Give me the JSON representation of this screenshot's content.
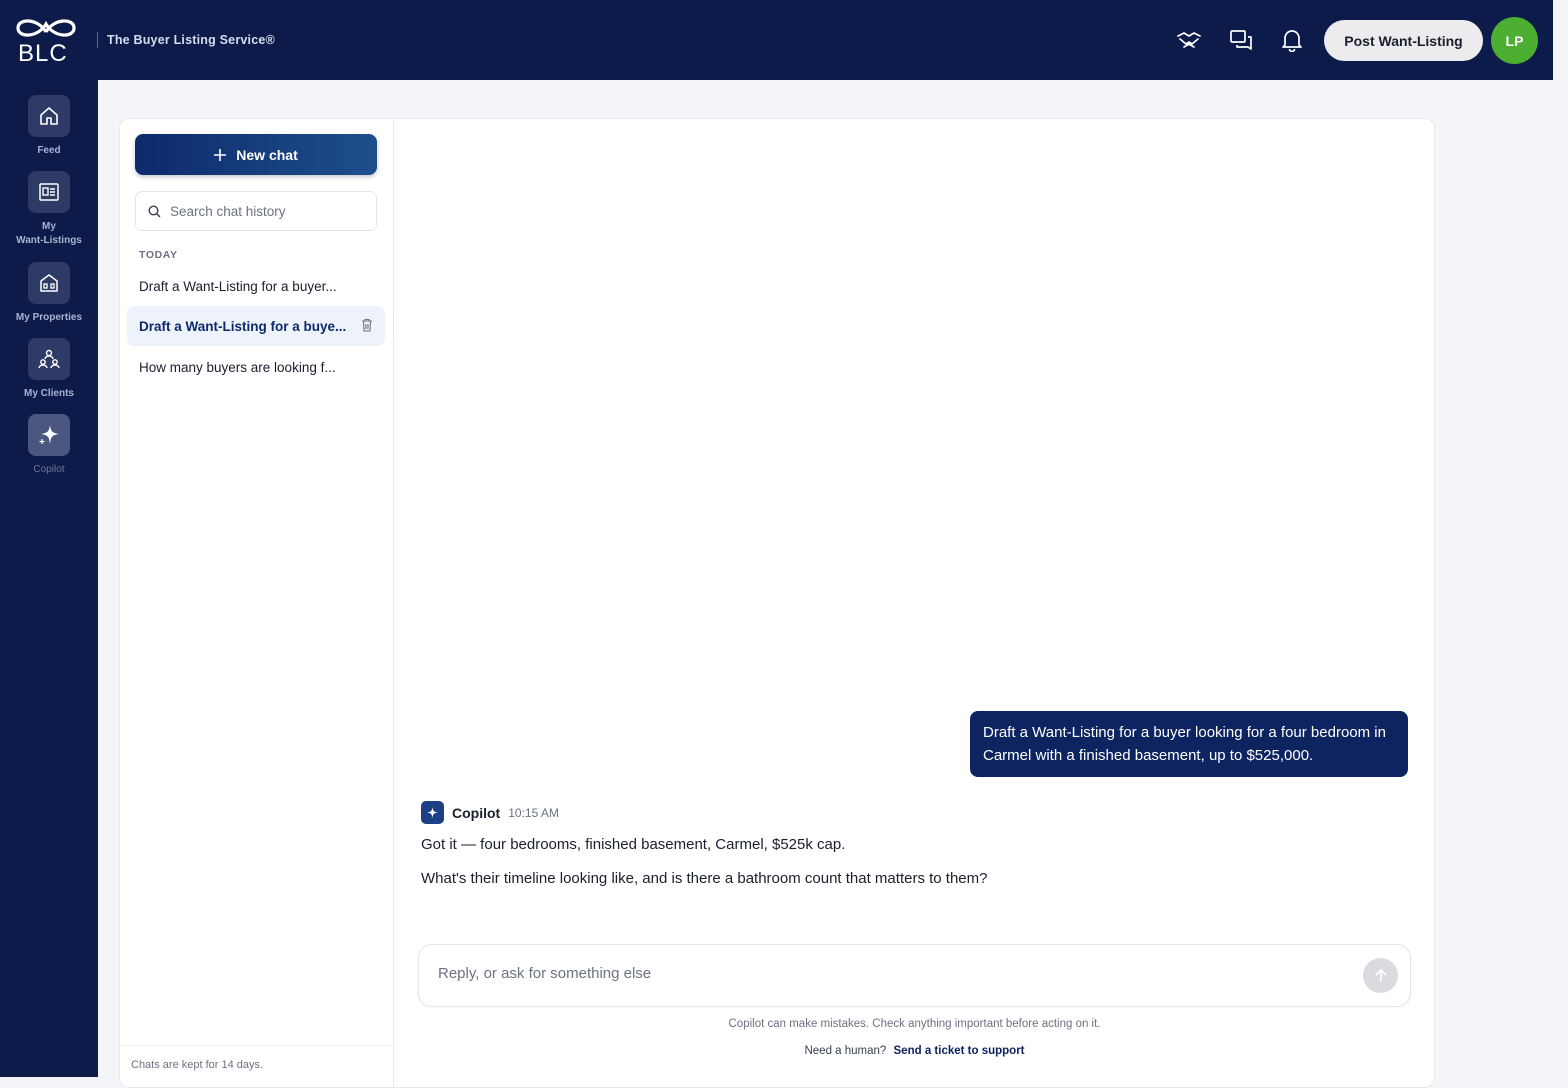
{
  "brand": {
    "logo_text": "BLC",
    "tagline": "The Buyer Listing Service®"
  },
  "header": {
    "post_button": "Post Want-Listing",
    "avatar_initials": "LP",
    "icons": [
      "handshake-icon",
      "chat-bubbles-icon",
      "bell-icon"
    ]
  },
  "rail": {
    "items": [
      {
        "label": "Feed",
        "icon": "home-icon"
      },
      {
        "label": "My\nWant-Listings",
        "icon": "listing-card-icon"
      },
      {
        "label": "My Properties",
        "icon": "building-icon"
      },
      {
        "label": "My Clients",
        "icon": "clients-icon"
      },
      {
        "label": "Copilot",
        "icon": "sparkle-icon",
        "active": true
      }
    ]
  },
  "sidebar": {
    "new_chat": "New chat",
    "search_placeholder": "Search chat history",
    "section": "TODAY",
    "history": [
      "Draft a Want-Listing for a buyer...",
      "Draft a Want-Listing for a buye...",
      "How many buyers are looking f..."
    ],
    "footer": "Chats are kept for 14 days."
  },
  "chat": {
    "user_message": "Draft a Want-Listing for a buyer looking for a four bedroom in Carmel with a finished basement, up to $525,000.",
    "bot_name": "Copilot",
    "bot_time": "10:15 AM",
    "bot_line1": "Got it — four bedrooms, finished basement, Carmel, $525k cap.",
    "bot_line2": "What's their timeline looking like, and is there a bathroom count that matters to them?",
    "reply_placeholder": "Reply, or ask for something else",
    "disclaimer": "Copilot can make mistakes. Check anything important before acting on it.",
    "support_prefix": "Need a human?",
    "support_link": "Send a ticket to support"
  },
  "colors": {
    "navy": "#0d1b4b",
    "accent": "#0d2460",
    "avatar": "#4caf32"
  }
}
